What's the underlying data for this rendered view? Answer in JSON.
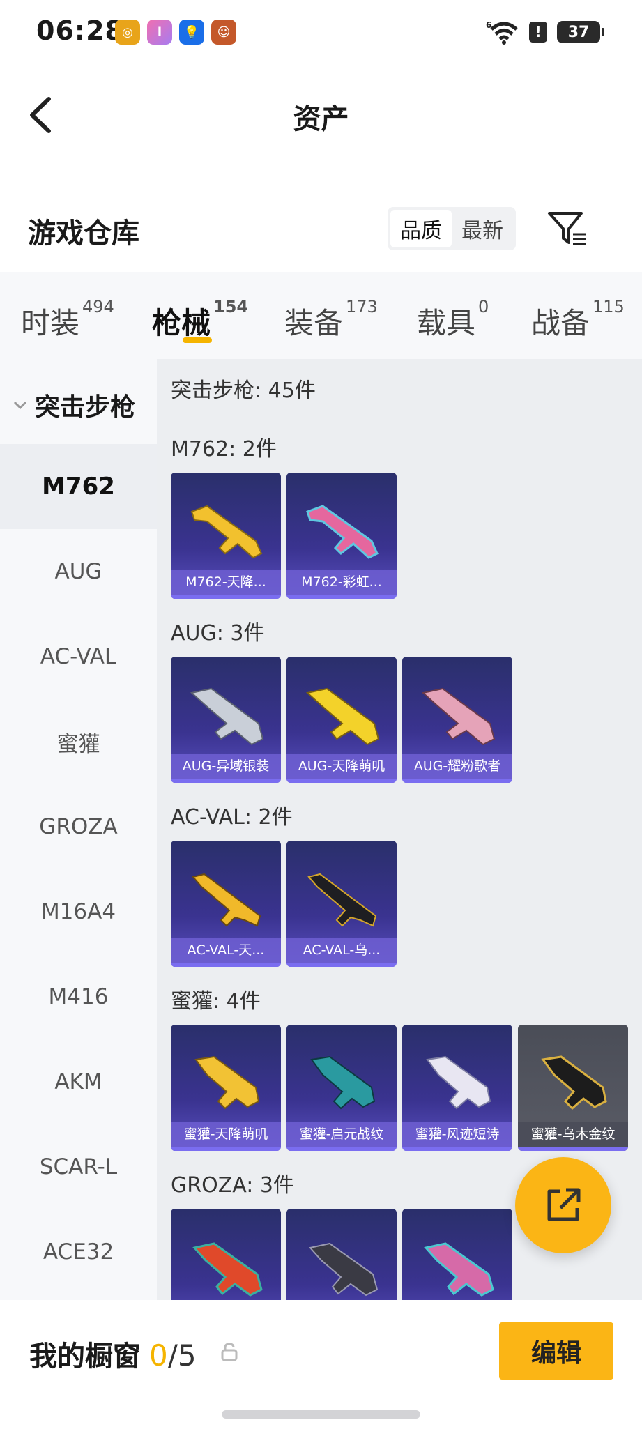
{
  "status": {
    "time": "06:28",
    "battery": "37",
    "alert": "!"
  },
  "nav": {
    "title": "资产"
  },
  "warehouse": {
    "title": "游戏仓库",
    "sort_options": [
      "品质",
      "最新"
    ]
  },
  "tabs": [
    {
      "label": "时装",
      "count": "494"
    },
    {
      "label": "枪械",
      "count": "154"
    },
    {
      "label": "装备",
      "count": "173"
    },
    {
      "label": "载具",
      "count": "0"
    },
    {
      "label": "战备",
      "count": "115"
    }
  ],
  "sidebar": {
    "category": "突击步枪",
    "items": [
      "M762",
      "AUG",
      "AC-VAL",
      "蜜獾",
      "GROZA",
      "M16A4",
      "M416",
      "AKM",
      "SCAR-L",
      "ACE32"
    ]
  },
  "content": {
    "header": "突击步枪: 45件",
    "groups": [
      {
        "title": "M762: 2件",
        "cards": [
          "M762-天降...",
          "M762-彩虹..."
        ]
      },
      {
        "title": "AUG: 3件",
        "cards": [
          "AUG-异域银装",
          "AUG-天降萌叽",
          "AUG-耀粉歌者"
        ]
      },
      {
        "title": "AC-VAL: 2件",
        "cards": [
          "AC-VAL-天...",
          "AC-VAL-乌..."
        ]
      },
      {
        "title": "蜜獾: 4件",
        "cards": [
          "蜜獾-天降萌叽",
          "蜜獾-启元战纹",
          "蜜獾-风迹短诗",
          "蜜獾-乌木金纹"
        ]
      },
      {
        "title": "GROZA: 3件",
        "cards": [
          "",
          "",
          ""
        ]
      }
    ]
  },
  "bottom": {
    "showcase_label": "我的橱窗",
    "current": "0",
    "separator_max": "/5",
    "edit_label": "编辑"
  },
  "colors": {
    "accent": "#fbb515",
    "card_bg": "#3a3390",
    "label_bg": "#6e5fd2"
  }
}
